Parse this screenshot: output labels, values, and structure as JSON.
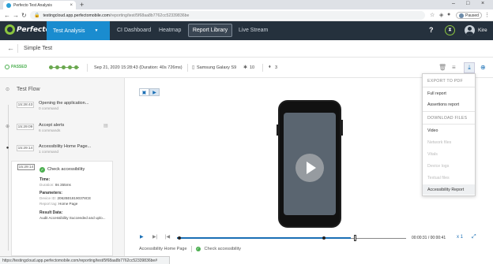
{
  "browser": {
    "tab_title": "Perfecto Test Analysis",
    "tab_close": "×",
    "new_tab": "+",
    "url_host": "testingcloud.app.perfectomobile.com",
    "url_path": "/reporting/test/5f68aa8b7762cc52339836be",
    "profile_status": "Paused",
    "win_min": "–",
    "win_max": "□",
    "win_close": "×"
  },
  "nav": {
    "logo_text": "Perfecto",
    "active_item": "Test Analysis",
    "items": [
      "CI Dashboard",
      "Heatmap",
      "Report Library",
      "Live Stream"
    ],
    "help": "?",
    "user_name": "Kire"
  },
  "test": {
    "name": "Simple Test",
    "status": "PASSED",
    "date": "Sep 21, 2020 15:28:43 (Duration: 40s 726ms)",
    "device": "Samsung Galaxy S9",
    "device_count": "10",
    "tag_count": "3"
  },
  "test_flow": {
    "title": "Test Flow",
    "items": [
      {
        "time": "15:28:43",
        "title": "Opening the application...",
        "sub": "0 command"
      },
      {
        "time": "15:29:09",
        "title": "Accept alerts",
        "sub": "6 commands"
      },
      {
        "time": "15:29:14",
        "title": "Accessibility Home Page...",
        "sub": "1 command"
      }
    ],
    "step": {
      "time": "15:29:14",
      "title": "Check accessibility",
      "time_label": "Time:",
      "duration_key": "Duration:",
      "duration_val": "8s 355ms",
      "params_label": "Parameters:",
      "device_key": "Device ID:",
      "device_val": "2062B018190378CE",
      "report_key": "Report tag:",
      "report_val": "Home Page",
      "result_label": "Result Data:",
      "result_text": "Audit Accessibility Succeeded and uplo..."
    }
  },
  "player": {
    "time": "00:00:31 / 00:00:41",
    "speed": "x 1",
    "caption_left": "Accessibility Home Page",
    "caption_right": "Check accessibility",
    "progress_fraction": 0.76
  },
  "dropdown": {
    "export_head": "EXPORT TO PDF",
    "full_report": "Full report",
    "assertions_report": "Assertions report",
    "download_head": "DOWNLOAD FILES",
    "video": "Video",
    "network_files": "Network files",
    "vitals": "Vitals",
    "device_logs": "Device logs",
    "textual_files": "Textual files",
    "accessibility_report": "Accessibility Report"
  },
  "status_bar": "https://testingcloud.app.perfectomobile.com/reporting/test/5f68aa8b7762cc52339836be#"
}
